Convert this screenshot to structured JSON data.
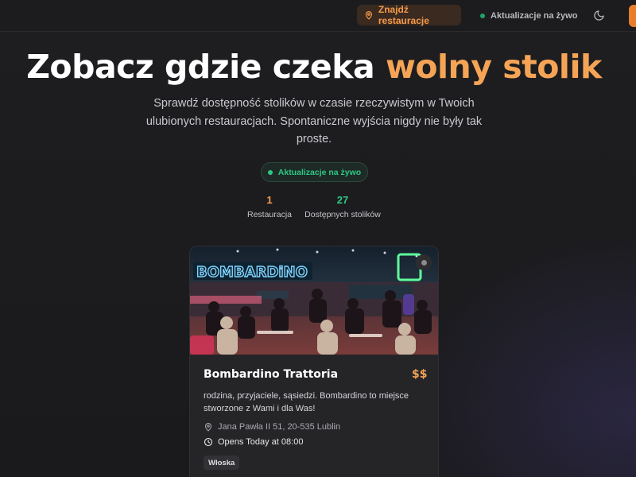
{
  "header": {
    "find_label": "Znajdź restauracje",
    "live_label": "Aktualizacje na żywo"
  },
  "hero": {
    "title_main": "Zobacz gdzie czeka ",
    "title_accent": "wolny stolik",
    "subtitle": "Sprawdź dostępność stolików w czasie rzeczywistym w Twoich ulubionych restauracjach. Spontaniczne wyjścia nigdy nie były tak proste.",
    "live_pill": "Aktualizacje na żywo"
  },
  "stats": [
    {
      "value": "1",
      "label": "Restauracja"
    },
    {
      "value": "27",
      "label": "Dostępnych stolików"
    }
  ],
  "restaurant": {
    "image_sign": "BOMBARDiNO",
    "name": "Bombardino Trattoria",
    "price": "$$",
    "description": "rodzina, przyjaciele, sąsiedzi. Bombardino to miejsce stworzone z Wami i dla Was!",
    "address": "Jana Pawła II 51, 20-535 Lublin",
    "hours": "Opens Today at 08:00",
    "cuisine": "Włoska"
  },
  "colors": {
    "accent_orange": "#f5a456",
    "live_green": "#2fc786",
    "background": "#1b1b1d"
  }
}
